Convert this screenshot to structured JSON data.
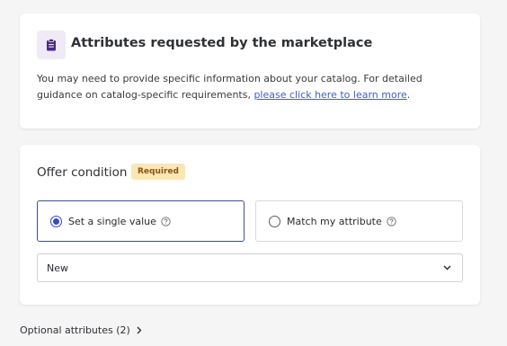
{
  "marketplace_card": {
    "icon": "clipboard-icon",
    "title": "Attributes requested by the marketplace",
    "description": "You may need to provide specific information about your catalog. For detailed guidance on catalog-specific requirements, ",
    "link_text": "please click here to learn more",
    "description_end": "."
  },
  "offer_condition": {
    "title": "Offer condition",
    "badge": "Required",
    "options": [
      {
        "label": "Set a single value",
        "selected": true,
        "icon": "help-circle-icon"
      },
      {
        "label": "Match my attribute",
        "selected": false,
        "icon": "help-circle-icon"
      }
    ],
    "select_value": "New",
    "select_icon": "chevron-down-icon"
  },
  "optional_attributes": {
    "label": "Optional attributes (2)",
    "icon": "chevron-right-icon"
  },
  "colors": {
    "accent": "#3548c7",
    "link": "#3b5fc9",
    "badge_bg": "#fbe7b5",
    "badge_text": "#8a5311",
    "icon_bg": "#efeaf6",
    "icon_fg": "#4a2a88"
  }
}
